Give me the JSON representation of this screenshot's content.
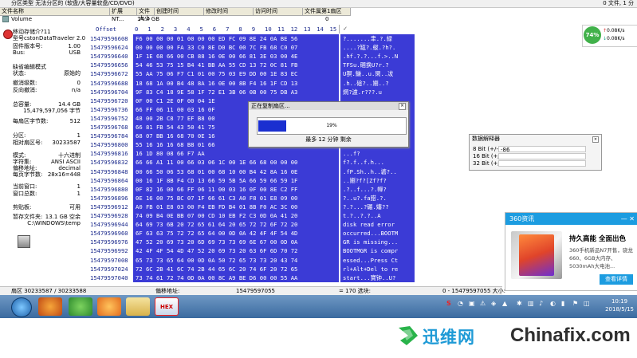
{
  "top_bar": {
    "title": "分区类型 无法分区的 (软盘/大容量软盘/CD/DVD)",
    "right_text": "0 文件, 1 分"
  },
  "file_table": {
    "headers": [
      "文件名称",
      "扩展",
      "文件大小",
      "创建时间",
      "修改时间",
      "访问时间",
      "文件属第1扇区"
    ],
    "volume_row": {
      "name": "Volume",
      "ext": "NT...",
      "size": "14.4 GB",
      "sector": "0"
    }
  },
  "left_panel": {
    "device_title": "移动存储介?11",
    "model": "型号cstonDataTraveler 2.0",
    "firmware_label": "固件版本号:",
    "firmware_value": "1.00",
    "bus_label": "Bus:",
    "bus_value": "USB",
    "edit_mode_label": "缺省编辑模式",
    "state_label": "状态:",
    "state_value": "原始的",
    "undo_count_label": "撤消级数:",
    "undo_count_value": "0",
    "reverse_undo_label": "反向撤消:",
    "reverse_undo_value": "n/a",
    "total_cap_label": "总容量:",
    "total_cap_value": "14.4 GB",
    "total_cap_bytes": "15,479,597,056 字节",
    "bytes_per_sector_label": "每扇区字节数:",
    "bytes_per_sector_value": "512",
    "partition_label": "分区:",
    "partition_value": "1",
    "relative_sector_label": "相对扇区号:",
    "relative_sector_value": "30233587",
    "mode_label": "模式:",
    "mode_value": "十六进制",
    "charset_label": "字符集:",
    "charset_value": "ANSI ASCII",
    "offset_addr_label": "偏移地址:",
    "offset_addr_value": "decimal",
    "bytes_per_page_label": "每页字节数:",
    "bytes_per_page_value": "28x16=448",
    "current_window_label": "当前窗口:",
    "current_window_value": "1",
    "total_windows_label": "窗口总数:",
    "total_windows_value": "1",
    "clipboard_label": "剪贴板:",
    "clipboard_value": "可用",
    "temp_folder_label": "暂存文件夹:",
    "temp_folder_value": "13.1 GB 空余",
    "temp_folder_path": "C:\\WINDOWS\\temp"
  },
  "hex_view": {
    "offset_header": "Offset",
    "columns": [
      "0",
      "1",
      "2",
      "3",
      "4",
      "5",
      "6",
      "7",
      "8",
      "9",
      "10",
      "11",
      "12",
      "13",
      "14",
      "15"
    ],
    "offsets": [
      "15479596608",
      "15479596624",
      "15479596640",
      "15479596656",
      "15479596672",
      "15479596688",
      "15479596704",
      "15479596720",
      "15479596736",
      "15479596752",
      "15479596768",
      "15479596784",
      "15479596800",
      "15479596816",
      "15479596832",
      "15479596848",
      "15479596864",
      "15479596880",
      "15479596896",
      "15479596912",
      "15479596928",
      "15479596944",
      "15479596960",
      "15479596976",
      "15479596992",
      "15479597008",
      "15479597024",
      "15479597040"
    ],
    "hex_rows": [
      "F6 00 00 00 01 00 00 00 ED FC 09 8E 24 0A BE 56",
      "00 00 00 00 FA 33 C0 8E D0 BC 00 7C FB 68 C0 07",
      "1F 1E 68 66 00 CB 88 16 0E 00 66 81 3E 03 00 4E",
      "54 46 53 75 15 B4 41 BB AA 55 CD 13 72 0C 81 FB",
      "55 AA 75 06 F7 C1 01 00 75 03 E9 DD 00 1E 83 EC",
      "18 68 1A 00 B4 48 8A 16 0E 00 8B F4 16 1F CD 13",
      "9F 83 C4 18 9E 58 1F 72 E1 3B 06 0B 00 75 DB A3",
      "0F 00 C1 2E 0F 00 04 1E",
      "66 FF 06 11 00 03 16 0F",
      "48 00 2B C8 77 EF B8 00",
      "66 81 FB 54 43 50 41 75",
      "68 07 BB 16 68 70 0E 16",
      "55 16 16 16 68 B8 01 66",
      "16 1D 80 08 66 F7 AA",
      "66 66 A1 11 00 66 03 06 1C 00 1E 66 68 00 00 00",
      "00 66 50 06 53 68 01 00 68 10 00 B4 42 8A 16 0E",
      "00 16 1F 8B F4 CD 13 66 59 5B 5A 66 59 66 59 1F",
      "0F 82 16 00 66 FF 06 11 00 03 16 0F 00 8E C2 FF",
      "0E 16 00 75 BC 07 1F 66 61 C3 A0 F8 01 E8 09 00",
      "A0 FB 01 E8 03 00 F4 EB FD B4 01 8B F0 AC 3C 00",
      "74 09 B4 0E BB 07 00 CD 10 EB F2 C3 0D 0A 41 20",
      "64 69 73 6B 20 72 65 61 64 20 65 72 72 6F 72 20",
      "6F 63 63 75 72 72 65 64 00 0D 0A 42 4F 4F 54 4D",
      "47 52 20 69 73 20 6D 69 73 73 69 6E 67 00 0D 0A",
      "42 4F 4F 54 4D 47 52 20 69 73 20 63 6F 6D 70 72",
      "65 73 73 65 64 00 0D 0A 50 72 65 73 73 20 43 74",
      "72 6C 2B 41 6C 74 2B 44 65 6C 20 74 6F 20 72 65",
      "73 74 61 72 74 0D 0A 00 8C A9 BE D6 00 00 55 AA"
    ],
    "ascii_rows": [
      "?.......聿.?.緑",
      "....?缻?.紱.?h?.",
      ".hf.?.?...f.>..N",
      "TFSu.碅换U?r.?",
      "U猽.鰜..u.閑..冹",
      ".h..碒?..嬼..?",
      "焹?濾.r???.u",
      "...",
      "f?..",
      "H.+",
      "f伆TCPAu",
      "h.?.hp..",
      "U...h?.f",
      "...f?",
      "f?.f..f.h...",
      ".fP.Sh..h..碆?..",
      "..嬼?f?[Zf?f?",
      ".?..f...?.幝?",
      "?..u?.fa腊.?.",
      "?.?...?碾.嬸??",
      "t.?..?.?..A",
      "disk read error",
      "occurred...BOOTM",
      "GR is missing...",
      "BOOTMGR is compr",
      "essed...Press Ct",
      "rl+Alt+Del to re",
      "start...寶钟..U?"
    ]
  },
  "copy_dialog": {
    "title": "正在复制扇区...",
    "progress_percent": 19,
    "progress_text": "19%",
    "remaining": "最多 12 分钟 剩余"
  },
  "data_interpreter": {
    "title": "数据解释器",
    "rows": [
      {
        "label": "8 Bit (+/-):",
        "value": "-86"
      },
      {
        "label": "16 Bit (+/-):",
        "value": ""
      },
      {
        "label": "32 Bit (+/-):",
        "value": ""
      }
    ]
  },
  "net_widget": {
    "percent": "74%",
    "up": "0.08K/s",
    "down": "0.08K/s"
  },
  "ad_popup": {
    "header": "360资讯",
    "title": "持久高能 全面出色",
    "desc_lines": [
      "360手机新品N7开售，骁龙",
      "660、6GB大内存、",
      "5030mAh大电池..."
    ],
    "button": "查看详情"
  },
  "status_bar": {
    "sector": "扇区 30233587 / 30233588",
    "offset_label": "偏移地址:",
    "offset_value": "15479597055",
    "selection": "= 170  选块:",
    "block": "0 - 15479597055  大小:"
  },
  "taskbar": {
    "time": "10:19",
    "date": "2018/5/15",
    "tray_s": "S"
  },
  "watermark": {
    "cn": "迅维网",
    "en": "Chinafix.com"
  }
}
